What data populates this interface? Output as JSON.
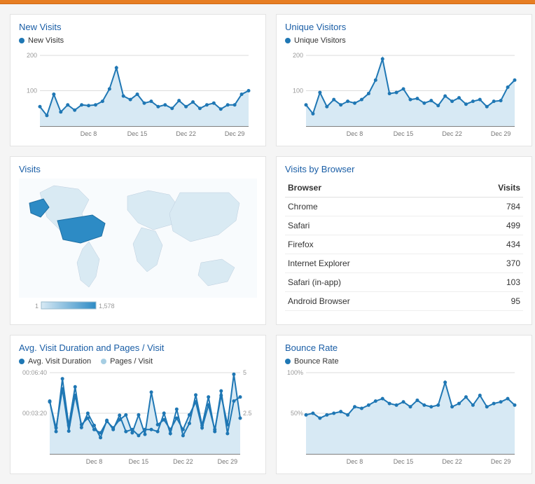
{
  "accent_color": "#e77e23",
  "series_color": "#1f77b4",
  "series_color_light": "#a6cee3",
  "cards": {
    "new_visits": {
      "title": "New Visits",
      "legend": "New Visits"
    },
    "unique": {
      "title": "Unique Visitors",
      "legend": "Unique Visitors"
    },
    "map": {
      "title": "Visits"
    },
    "browser": {
      "title": "Visits by Browser"
    },
    "duration": {
      "title": "Avg. Visit Duration and Pages / Visit",
      "legend_a": "Avg. Visit Duration",
      "legend_b": "Pages / Visit"
    },
    "bounce": {
      "title": "Bounce Rate",
      "legend": "Bounce Rate"
    }
  },
  "browser_table": {
    "headers": {
      "browser": "Browser",
      "visits": "Visits"
    },
    "rows": [
      {
        "browser": "Chrome",
        "visits": 784
      },
      {
        "browser": "Safari",
        "visits": 499
      },
      {
        "browser": "Firefox",
        "visits": 434
      },
      {
        "browser": "Internet Explorer",
        "visits": 370
      },
      {
        "browser": "Safari (in-app)",
        "visits": 103
      },
      {
        "browser": "Android Browser",
        "visits": 95
      }
    ]
  },
  "map_legend": {
    "min": "1",
    "max": "1,578"
  },
  "chart_data": [
    {
      "id": "new_visits",
      "type": "area",
      "title": "New Visits",
      "x_ticks": [
        "Dec 8",
        "Dec 15",
        "Dec 22",
        "Dec 29"
      ],
      "ylim": [
        0,
        210
      ],
      "y_ticks": [
        100,
        200
      ],
      "series": [
        {
          "name": "New Visits",
          "values": [
            55,
            30,
            90,
            40,
            60,
            45,
            60,
            58,
            60,
            70,
            105,
            165,
            85,
            75,
            90,
            65,
            70,
            55,
            60,
            50,
            72,
            55,
            68,
            50,
            60,
            65,
            48,
            60,
            60,
            90,
            100
          ]
        }
      ]
    },
    {
      "id": "unique",
      "type": "area",
      "title": "Unique Visitors",
      "x_ticks": [
        "Dec 8",
        "Dec 15",
        "Dec 22",
        "Dec 29"
      ],
      "ylim": [
        0,
        210
      ],
      "y_ticks": [
        100,
        200
      ],
      "series": [
        {
          "name": "Unique Visitors",
          "values": [
            60,
            35,
            95,
            55,
            75,
            60,
            70,
            65,
            75,
            92,
            130,
            190,
            92,
            95,
            105,
            75,
            78,
            65,
            72,
            58,
            85,
            70,
            80,
            62,
            70,
            75,
            55,
            70,
            72,
            110,
            130
          ]
        }
      ]
    },
    {
      "id": "bounce",
      "type": "area",
      "title": "Bounce Rate",
      "x_ticks": [
        "Dec 8",
        "Dec 15",
        "Dec 22",
        "Dec 29"
      ],
      "ylim": [
        0,
        100
      ],
      "y_ticks": [
        50,
        100
      ],
      "y_tick_labels": [
        "50%",
        "100%"
      ],
      "series": [
        {
          "name": "Bounce Rate",
          "values": [
            48,
            50,
            44,
            48,
            50,
            52,
            48,
            58,
            56,
            60,
            65,
            68,
            62,
            60,
            64,
            58,
            66,
            60,
            58,
            60,
            88,
            58,
            62,
            70,
            60,
            72,
            58,
            62,
            64,
            68,
            60
          ]
        }
      ]
    },
    {
      "id": "duration",
      "type": "line",
      "title": "Avg. Visit Duration and Pages / Visit",
      "x_ticks": [
        "Dec 8",
        "Dec 15",
        "Dec 22",
        "Dec 29"
      ],
      "left_axis": {
        "name": "Avg. Visit Duration",
        "lim": [
          0,
          400
        ],
        "ticks": [
          200,
          400
        ],
        "tick_labels": [
          "00:03:20",
          "00:06:40"
        ]
      },
      "right_axis": {
        "name": "Pages / Visit",
        "lim": [
          0,
          5
        ],
        "ticks": [
          2.5,
          5
        ],
        "tick_labels": [
          "2.5",
          "5"
        ]
      },
      "series": [
        {
          "name": "Avg. Visit Duration",
          "axis": "left",
          "values": [
            260,
            110,
            370,
            140,
            330,
            130,
            200,
            140,
            80,
            165,
            120,
            190,
            110,
            120,
            90,
            120,
            120,
            110,
            200,
            100,
            220,
            90,
            150,
            290,
            140,
            280,
            110,
            310,
            100,
            260,
            280
          ]
        },
        {
          "name": "Pages / Visit",
          "axis": "right",
          "values": [
            3.2,
            1.6,
            4.0,
            1.4,
            3.6,
            1.8,
            2.2,
            1.5,
            1.3,
            2.0,
            1.6,
            2.1,
            2.4,
            1.3,
            2.4,
            1.2,
            3.8,
            1.8,
            2.1,
            1.5,
            2.2,
            1.5,
            2.4,
            3.2,
            1.6,
            3.0,
            1.5,
            3.6,
            1.8,
            4.9,
            2.2
          ]
        }
      ]
    }
  ]
}
